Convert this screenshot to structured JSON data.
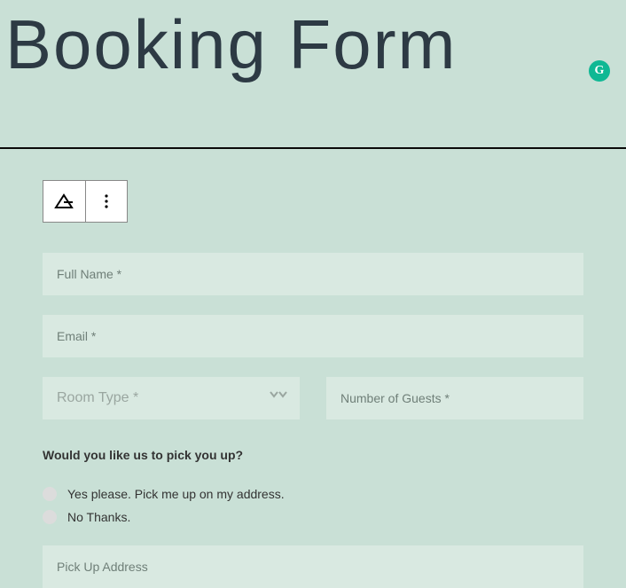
{
  "title": "Booking Form",
  "badge": {
    "letter": "G"
  },
  "fields": {
    "fullName": {
      "placeholder": "Full Name *"
    },
    "email": {
      "placeholder": "Email *"
    },
    "roomType": {
      "placeholder": "Room Type *"
    },
    "guests": {
      "placeholder": "Number of Guests *"
    },
    "pickupAddress": {
      "placeholder": "Pick Up Address"
    }
  },
  "question": "Would you like us to pick you up?",
  "options": {
    "yes": "Yes please. Pick me up on my address.",
    "no": "No Thanks."
  }
}
